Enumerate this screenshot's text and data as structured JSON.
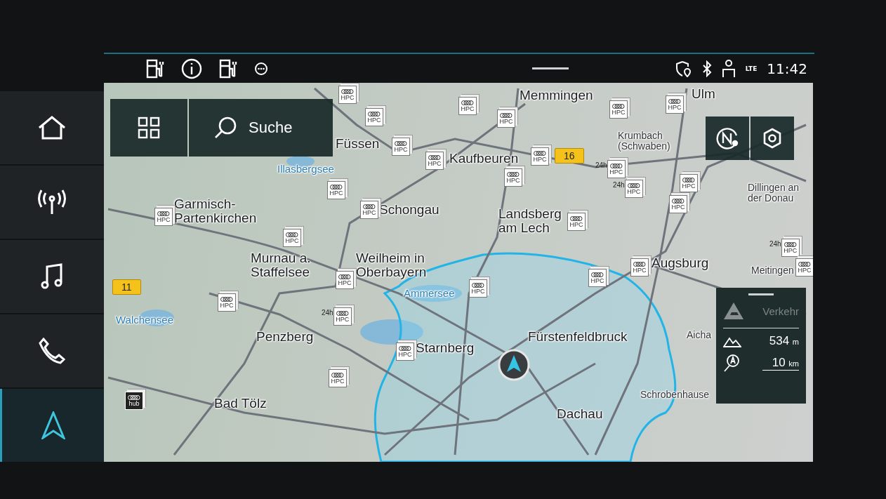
{
  "status_bar": {
    "network_label": "LTE",
    "time": "11:42"
  },
  "sidebar": {
    "items": [
      {
        "kind": "home",
        "selected": false
      },
      {
        "kind": "radio",
        "selected": false
      },
      {
        "kind": "media",
        "selected": false
      },
      {
        "kind": "phone",
        "selected": false
      },
      {
        "kind": "navigation",
        "selected": true
      }
    ]
  },
  "map": {
    "search": {
      "label": "Suche"
    },
    "labels": [
      {
        "kind": "city",
        "text": "Memmingen"
      },
      {
        "kind": "city",
        "text": "Ulm"
      },
      {
        "kind": "city",
        "text": "Füssen"
      },
      {
        "kind": "city",
        "text": "Kaufbeuren"
      },
      {
        "kind": "town",
        "text": "Krumbach\n(Schwaben)"
      },
      {
        "kind": "lake",
        "text": "Illasbergsee"
      },
      {
        "kind": "town",
        "text": "Dillingen an\nder Donau"
      },
      {
        "kind": "city",
        "text": "Garmisch-\nPartenkirchen"
      },
      {
        "kind": "city",
        "text": "Schongau"
      },
      {
        "kind": "city",
        "text": "Landsberg\nam Lech"
      },
      {
        "kind": "city",
        "text": "Murnau a.\nStaffelsee"
      },
      {
        "kind": "city",
        "text": "Weilheim in\nOberbayern"
      },
      {
        "kind": "city",
        "text": "Augsburg"
      },
      {
        "kind": "town",
        "text": "Meitingen"
      },
      {
        "kind": "lake",
        "text": "Ammersee"
      },
      {
        "kind": "lake",
        "text": "Walchensee"
      },
      {
        "kind": "city",
        "text": "Penzberg"
      },
      {
        "kind": "city",
        "text": "Starnberg"
      },
      {
        "kind": "city",
        "text": "Fürstenfeldbruck"
      },
      {
        "kind": "town",
        "text": "Aicha"
      },
      {
        "kind": "city",
        "text": "Bad Tölz"
      },
      {
        "kind": "town",
        "text": "Schrobenhause"
      },
      {
        "kind": "city",
        "text": "Dachau"
      }
    ],
    "road_badges": [
      {
        "text": "16"
      },
      {
        "text": "11"
      }
    ],
    "stations": [
      {
        "kind": "hpc",
        "label": "HPC"
      },
      {
        "kind": "hpc",
        "label": "HPC"
      },
      {
        "kind": "hpc",
        "label": "HPC"
      },
      {
        "kind": "hpc",
        "label": "HPC"
      },
      {
        "kind": "hpc",
        "label": "HPC"
      },
      {
        "kind": "hpc",
        "label": "HPC"
      },
      {
        "kind": "hpc",
        "label": "HPC"
      },
      {
        "kind": "hpc",
        "label": "HPC"
      },
      {
        "kind": "hpc",
        "label": "HPC"
      },
      {
        "kind": "hpc",
        "label": "HPC"
      },
      {
        "kind": "hpc24",
        "prefix": "24h",
        "label": "HPC"
      },
      {
        "kind": "hpc24",
        "prefix": "24h",
        "label": "HPC"
      },
      {
        "kind": "hpc",
        "label": "HPC"
      },
      {
        "kind": "hpc",
        "label": "HPC"
      },
      {
        "kind": "hpc",
        "label": "HPC"
      },
      {
        "kind": "hpc",
        "label": "HPC"
      },
      {
        "kind": "hpc",
        "label": "HPC"
      },
      {
        "kind": "hpc",
        "label": "HPC"
      },
      {
        "kind": "hpc",
        "label": "HPC"
      },
      {
        "kind": "hpc",
        "label": "HPC"
      },
      {
        "kind": "hpc",
        "label": "HPC"
      },
      {
        "kind": "hpc",
        "label": "HPC"
      },
      {
        "kind": "hpc",
        "label": "HPC"
      },
      {
        "kind": "hpc24",
        "prefix": "24h",
        "label": "HPC"
      },
      {
        "kind": "hpc",
        "label": "HPC"
      },
      {
        "kind": "hpc",
        "label": "HPC"
      },
      {
        "kind": "hpc24",
        "prefix": "24h",
        "label": "HPC"
      },
      {
        "kind": "hpc",
        "label": "HPC"
      },
      {
        "kind": "hpc",
        "label": "HPC"
      },
      {
        "kind": "hub",
        "label": "hub"
      }
    ]
  },
  "info_panel": {
    "traffic": {
      "label": "Verkehr",
      "disabled": true
    },
    "altitude": {
      "value": "534",
      "unit": "m"
    },
    "scale": {
      "value": "10",
      "unit": "km"
    }
  }
}
